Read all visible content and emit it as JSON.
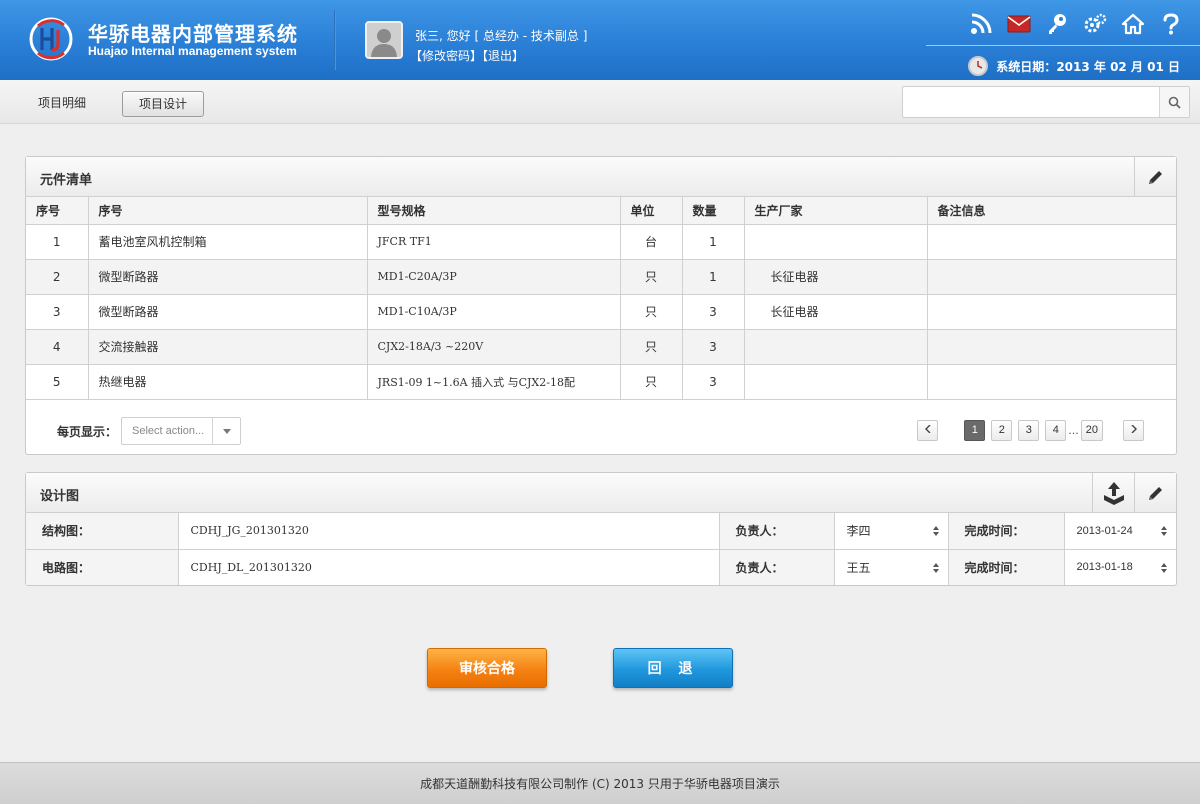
{
  "header": {
    "brand_cn": "华骄电器内部管理系统",
    "brand_en": "Huajao Internal management system",
    "greeting": "张三, 您好 [ 总经办 - 技术副总 ]",
    "change_password": "【修改密码】",
    "logout": "【退出】",
    "icons": [
      "rss-icon",
      "mail-icon",
      "key-icon",
      "settings-icon",
      "home-icon",
      "help-icon"
    ],
    "system_date_label": "系统日期：",
    "system_date": "2013 年 02 月 01 日"
  },
  "toolbar": {
    "tabs": [
      {
        "label": "项目明细"
      },
      {
        "label": "项目设计"
      }
    ],
    "active_tab": "项目设计",
    "search_placeholder": ""
  },
  "components": {
    "title": "元件清单",
    "columns": [
      "序号",
      "序号",
      "型号规格",
      "单位",
      "数量",
      "生产厂家",
      "备注信息"
    ],
    "rows": [
      {
        "no": "1",
        "name": "蓄电池室风机控制箱",
        "spec": "JFCR TF1",
        "unit": "台",
        "qty": "1",
        "maker": "",
        "note": ""
      },
      {
        "no": "2",
        "name": "微型断路器",
        "spec": "MD1-C20A/3P",
        "unit": "只",
        "qty": "1",
        "maker": "长征电器",
        "note": ""
      },
      {
        "no": "3",
        "name": "微型断路器",
        "spec": "MD1-C10A/3P",
        "unit": "只",
        "qty": "3",
        "maker": "长征电器",
        "note": ""
      },
      {
        "no": "4",
        "name": "交流接触器",
        "spec": "CJX2-18A/3 ~220V",
        "unit": "只",
        "qty": "3",
        "maker": "",
        "note": ""
      },
      {
        "no": "5",
        "name": "热继电器",
        "spec": "JRS1-09  1~1.6A 插入式 与CJX2-18配",
        "unit": "只",
        "qty": "3",
        "maker": "",
        "note": ""
      }
    ],
    "per_page_label": "每页显示：",
    "per_page_placeholder": "Select action...",
    "pages": [
      "1",
      "2",
      "3",
      "4",
      "20"
    ],
    "ellipsis": "...",
    "current_page": "1"
  },
  "design": {
    "title": "设计图",
    "rows": [
      {
        "label": "结构图：",
        "file": "CDHJ_JG_201301320",
        "owner_label": "负责人：",
        "owner": "李四",
        "date_label": "完成时间：",
        "date": "2013-01-24"
      },
      {
        "label": "电路图：",
        "file": "CDHJ_DL_201301320",
        "owner_label": "负责人：",
        "owner": "王五",
        "date_label": "完成时间：",
        "date": "2013-01-18"
      }
    ]
  },
  "actions": {
    "approve": "审核合格",
    "back": "回 退"
  },
  "footer": {
    "text": "成都天道酬勤科技有限公司制作 (C) 2013 只用于华骄电器项目演示"
  },
  "colors": {
    "header_blue": "#2a7fd6",
    "approve_orange": "#f58212",
    "back_blue": "#1f97dd"
  }
}
